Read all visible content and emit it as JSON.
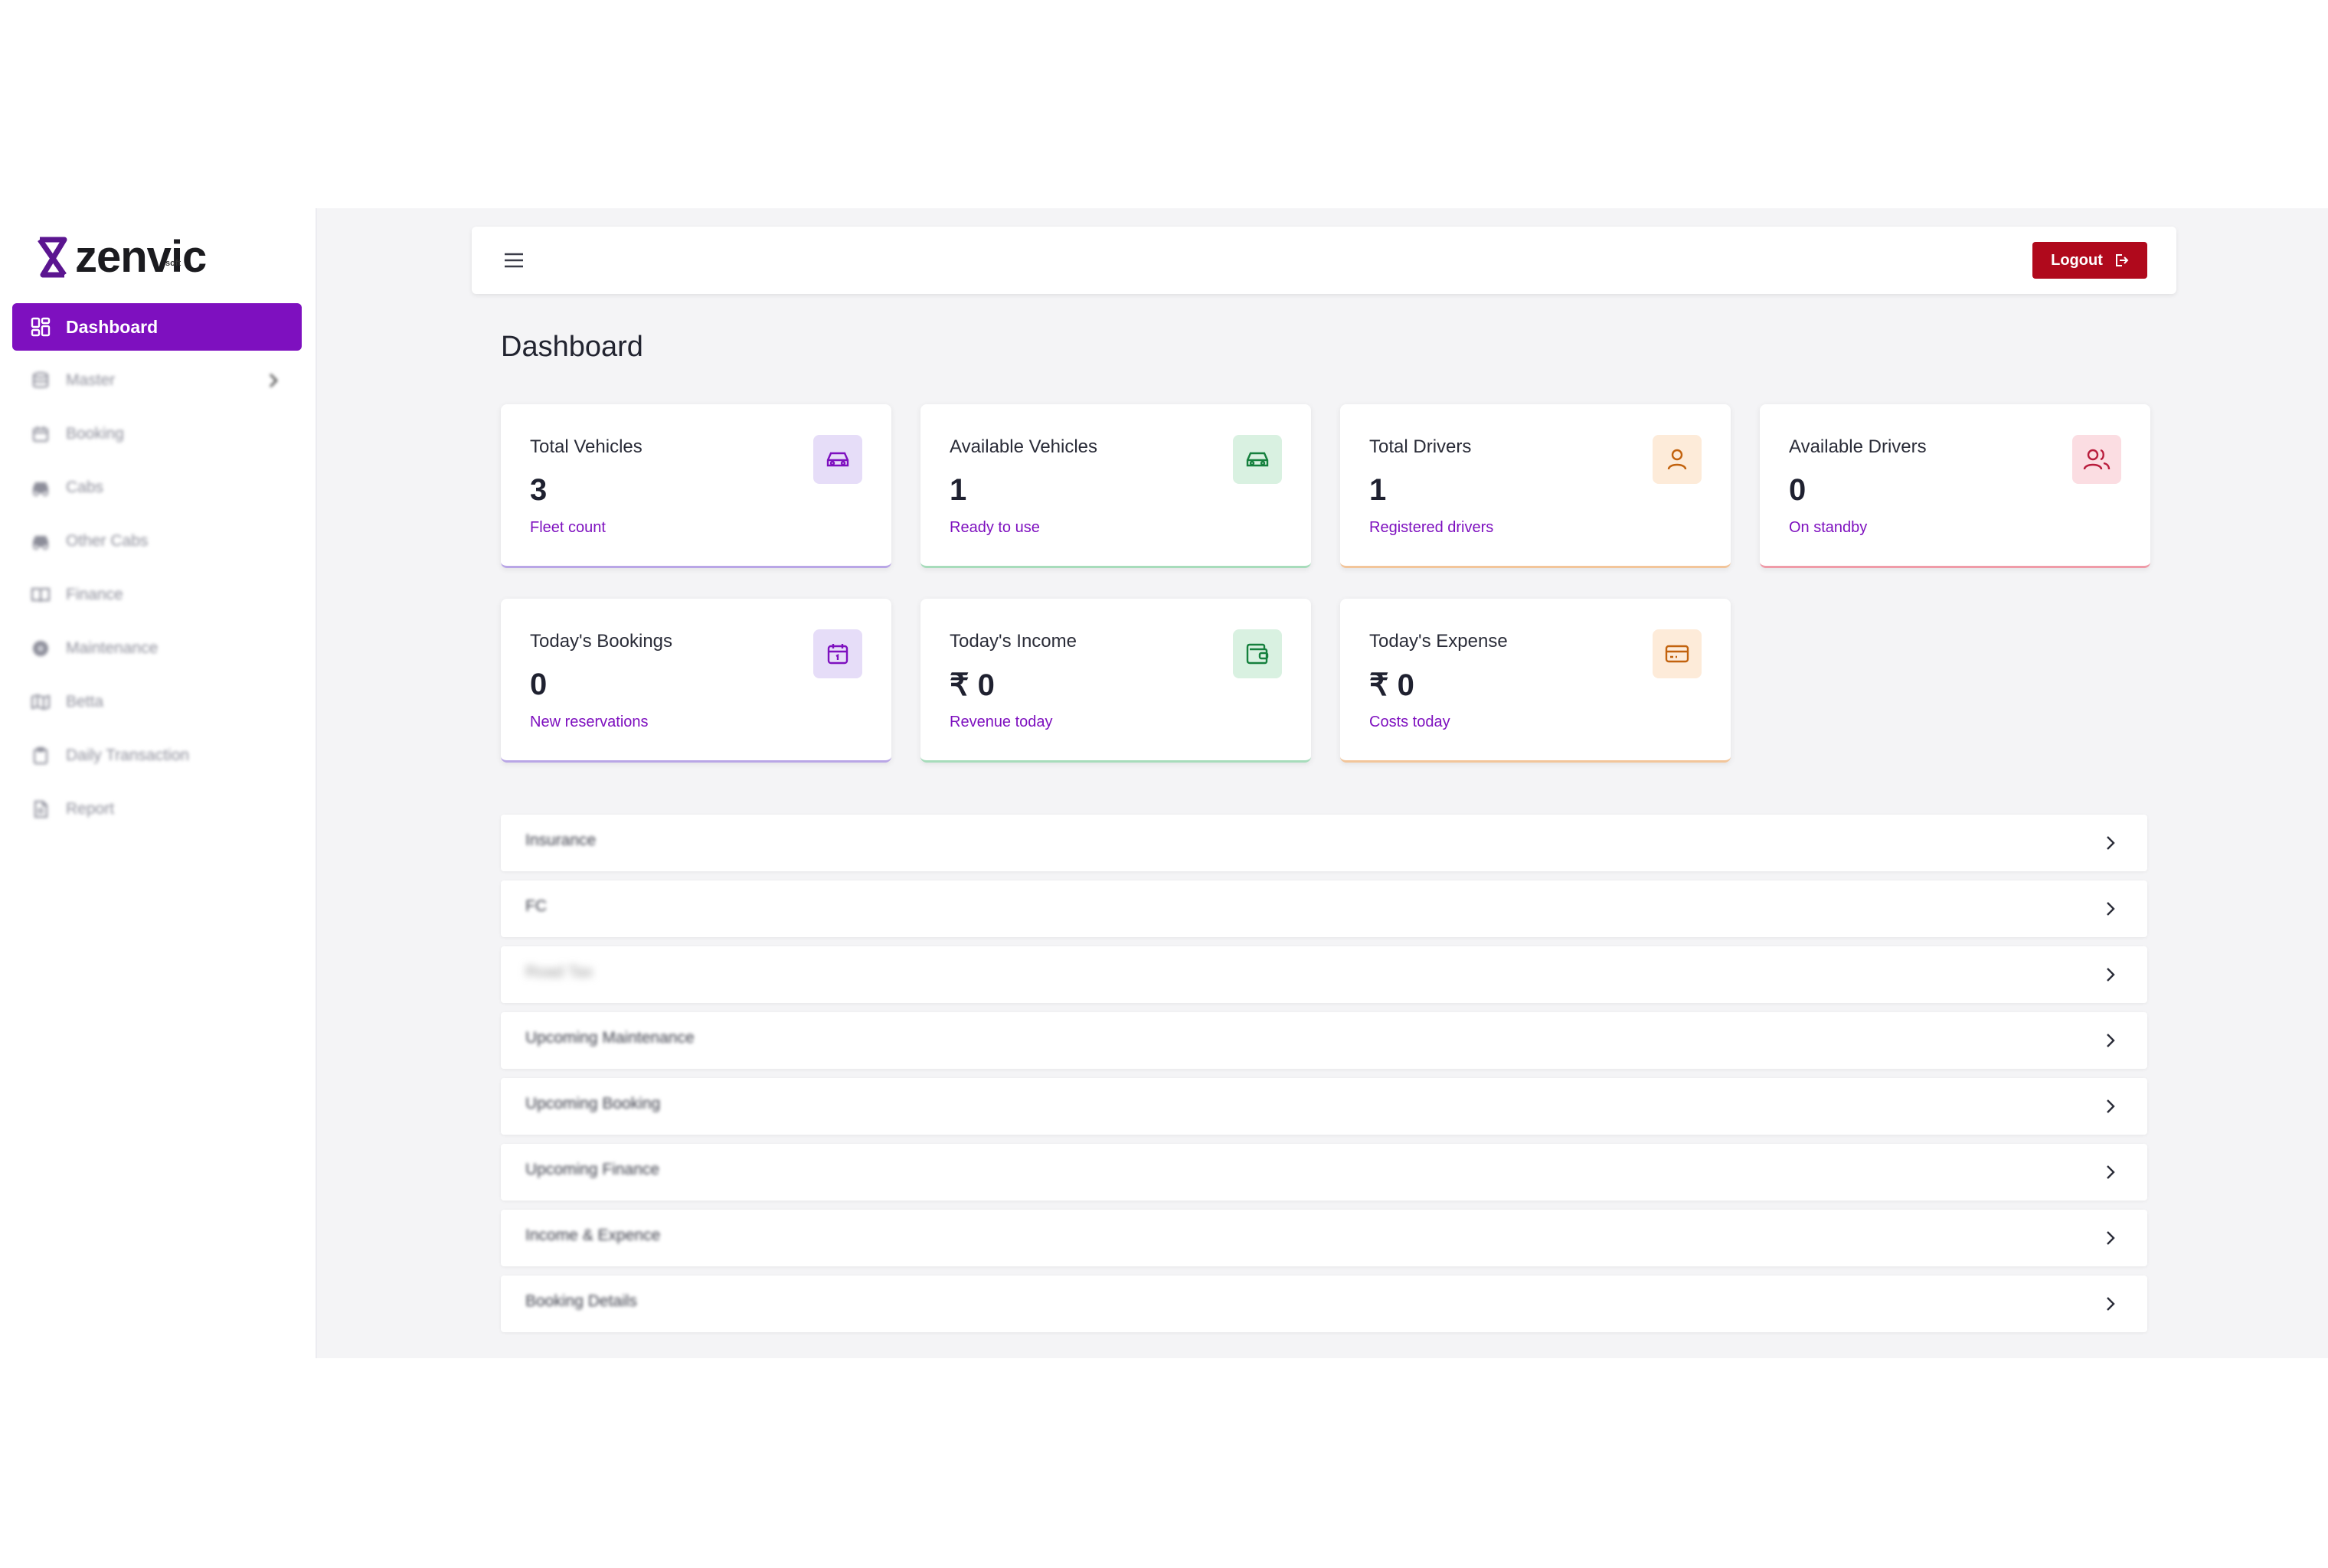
{
  "brand": {
    "name": "zenvic",
    "sub": "soft",
    "accent": "#7e10bf"
  },
  "sidebar": {
    "items": [
      {
        "label": "Dashboard",
        "icon": "dashboard-grid-icon",
        "active": true
      },
      {
        "label": "Master",
        "icon": "database-icon",
        "has_children": true
      },
      {
        "label": "Booking",
        "icon": "calendar-icon"
      },
      {
        "label": "Cabs",
        "icon": "car-icon"
      },
      {
        "label": "Other Cabs",
        "icon": "car-icon"
      },
      {
        "label": "Finance",
        "icon": "book-icon"
      },
      {
        "label": "Maintenance",
        "icon": "gear-icon"
      },
      {
        "label": "Betta",
        "icon": "map-icon"
      },
      {
        "label": "Daily Transaction",
        "icon": "clipboard-icon"
      },
      {
        "label": "Report",
        "icon": "file-icon"
      }
    ]
  },
  "header": {
    "logout_label": "Logout",
    "menu_icon": "hamburger-menu-icon"
  },
  "page": {
    "title": "Dashboard"
  },
  "stats": [
    {
      "label": "Total Vehicles",
      "value": "3",
      "sub": "Fleet count",
      "icon": "car-icon",
      "color": "#7e10bf"
    },
    {
      "label": "Available Vehicles",
      "value": "1",
      "sub": "Ready to use",
      "icon": "car-icon",
      "color": "#15803d"
    },
    {
      "label": "Total Drivers",
      "value": "1",
      "sub": "Registered drivers",
      "icon": "user-icon",
      "color": "#c2620d"
    },
    {
      "label": "Available Drivers",
      "value": "0",
      "sub": "On standby",
      "icon": "users-icon",
      "color": "#b91c3c"
    },
    {
      "label": "Today's Bookings",
      "value": "0",
      "sub": "New reservations",
      "icon": "calendar-icon",
      "color": "#7e10bf"
    },
    {
      "label": "Today's Income",
      "value": "₹ 0",
      "sub": "Revenue today",
      "icon": "wallet-icon",
      "color": "#15803d"
    },
    {
      "label": "Today's Expense",
      "value": "₹ 0",
      "sub": "Costs today",
      "icon": "credit-card-icon",
      "color": "#c2620d"
    }
  ],
  "sections": [
    {
      "label": "Insurance"
    },
    {
      "label": "FC"
    },
    {
      "label": "Road Tax"
    },
    {
      "label": "Upcoming Maintenance"
    },
    {
      "label": "Upcoming Booking"
    },
    {
      "label": "Upcoming Finance"
    },
    {
      "label": "Income & Expence"
    },
    {
      "label": "Booking Details"
    }
  ]
}
